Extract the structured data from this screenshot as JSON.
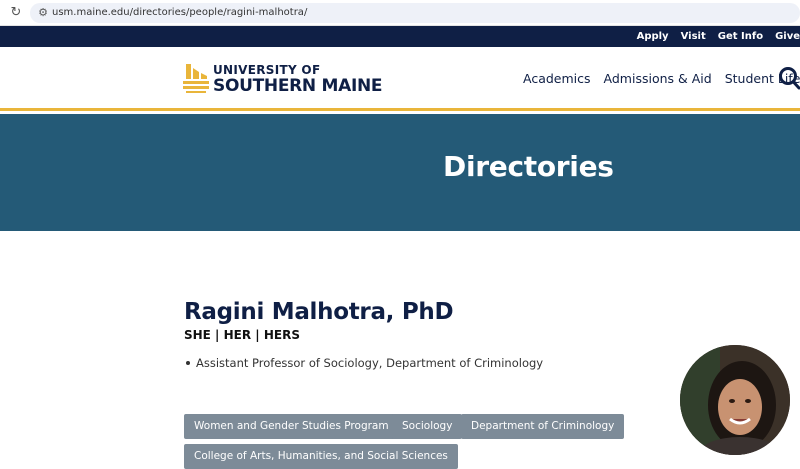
{
  "browser": {
    "url": "usm.maine.edu/directories/people/ragini-malhotra/"
  },
  "utility_nav": {
    "items": [
      "Apply",
      "Visit",
      "Get Info",
      "Give"
    ]
  },
  "header": {
    "logo_line1": "UNIVERSITY OF",
    "logo_line2": "SOUTHERN MAINE",
    "nav": [
      "Academics",
      "Admissions & Aid",
      "Student Life"
    ],
    "search_icon": "search-icon"
  },
  "hero": {
    "title": "Directories"
  },
  "profile": {
    "name": "Ragini Malhotra, PhD",
    "pronouns": "SHE | HER | HERS",
    "titles": [
      "Assistant Professor of Sociology, Department of Criminology"
    ],
    "tags": [
      "Women and Gender Studies Program",
      "Sociology",
      "Department of Criminology",
      "College of Arts, Humanities, and Social Sciences"
    ]
  },
  "colors": {
    "navy": "#0f1f45",
    "gold": "#e9b53a",
    "hero_blue": "#245a77",
    "tag_gray": "#7d8b98"
  }
}
